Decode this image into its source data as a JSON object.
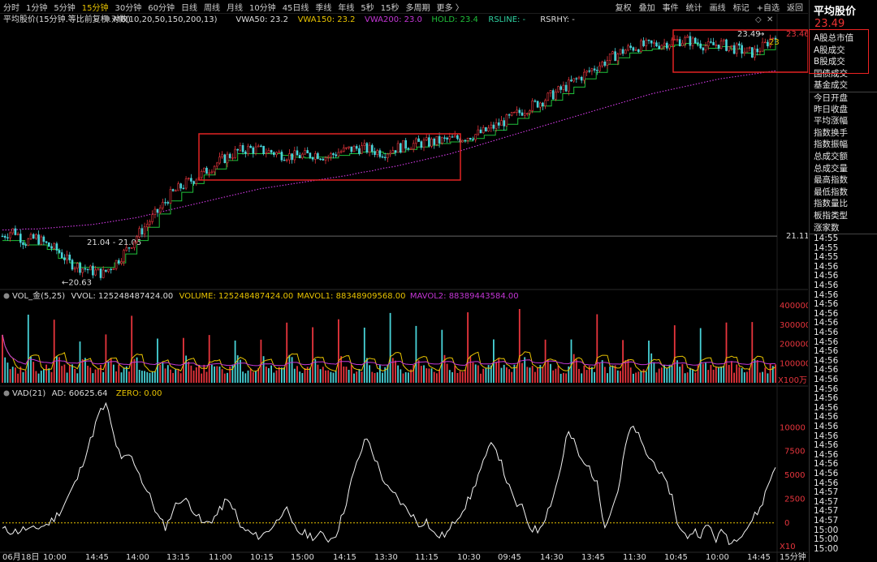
{
  "toolbar": {
    "periods": [
      "分时",
      "1分钟",
      "5分钟",
      "15分钟",
      "30分钟",
      "60分钟",
      "日线",
      "周线",
      "月线",
      "10分钟",
      "45日线",
      "季线",
      "年线",
      "5秒",
      "15秒",
      "多周期",
      "更多 〉"
    ],
    "active_period": "15分钟",
    "tools": [
      "复权",
      "叠加",
      "事件",
      "统计",
      "画线",
      "标记",
      "+自选",
      "返回"
    ]
  },
  "header": {
    "title": "平均股价(15分钟.等比前复权.对数)",
    "ma_label": "M6(10,20,50,150,200,13)",
    "vwa50": "VWA50: 23.2",
    "vwa150": "VWA150: 23.2",
    "vwa200": "VWA200: 23.0",
    "hold": "HOLD: 23.4",
    "rsline": "RSLINE: -",
    "rsrhy": "RSRHY: -"
  },
  "colors": {
    "up": "#e8353d",
    "down": "#48d3d8",
    "hold": "#1fbf3a",
    "vwa": "#c436d6",
    "vwa150": "#e8c300",
    "mavol1": "#e8c300",
    "mavol2": "#c436d6",
    "highlight": "#e22222"
  },
  "price_axis": {
    "labels": [
      "23.46",
      "21.11"
    ],
    "ref_label": "21.04 - 21.05",
    "low_label": "←20.63",
    "high_label": "23.49"
  },
  "price_chart": {
    "close": [
      21.05,
      21.12,
      20.98,
      21.03,
      20.95,
      20.88,
      20.75,
      20.7,
      20.66,
      20.63,
      20.74,
      20.88,
      21.05,
      21.2,
      21.35,
      21.52,
      21.62,
      21.7,
      21.78,
      21.88,
      21.96,
      22.03,
      22.06,
      22.04,
      22.02,
      21.99,
      21.97,
      21.98,
      22.0,
      21.96,
      22.02,
      22.05,
      22.07,
      22.04,
      22.01,
      22.06,
      22.1,
      22.12,
      22.13,
      22.15,
      22.17,
      22.19,
      22.22,
      22.26,
      22.33,
      22.4,
      22.48,
      22.56,
      22.62,
      22.7,
      22.78,
      22.87,
      22.96,
      23.05,
      23.13,
      23.22,
      23.28,
      23.31,
      23.32,
      23.34,
      23.37,
      23.38,
      23.35,
      23.3,
      23.34,
      23.29,
      23.25,
      23.22,
      23.31,
      23.46
    ],
    "hold": [
      21.0,
      21.0,
      20.95,
      20.95,
      20.9,
      20.8,
      20.75,
      20.7,
      20.7,
      20.7,
      20.75,
      20.85,
      21.0,
      21.15,
      21.3,
      21.45,
      21.55,
      21.65,
      21.75,
      21.82,
      21.92,
      22.0,
      22.0,
      22.0,
      22.0,
      21.98,
      21.96,
      21.95,
      21.96,
      21.95,
      21.98,
      22.0,
      22.02,
      22.02,
      22.0,
      22.02,
      22.05,
      22.08,
      22.1,
      22.12,
      22.14,
      22.15,
      22.18,
      22.22,
      22.28,
      22.35,
      22.42,
      22.5,
      22.57,
      22.64,
      22.72,
      22.8,
      22.9,
      22.98,
      23.08,
      23.16,
      23.22,
      23.25,
      23.27,
      23.3,
      23.32,
      23.34,
      23.32,
      23.28,
      23.3,
      23.27,
      23.22,
      23.2,
      23.26,
      23.4
    ],
    "vwa200": [
      21.12,
      21.12,
      21.13,
      21.13,
      21.14,
      21.15,
      21.16,
      21.17,
      21.18,
      21.2,
      21.22,
      21.24,
      21.26,
      21.29,
      21.32,
      21.35,
      21.38,
      21.41,
      21.44,
      21.47,
      21.5,
      21.53,
      21.56,
      21.59,
      21.61,
      21.63,
      21.65,
      21.67,
      21.69,
      21.71,
      21.73,
      21.75,
      21.78,
      21.8,
      21.83,
      21.85,
      21.88,
      21.91,
      21.94,
      21.97,
      22.0,
      22.04,
      22.08,
      22.12,
      22.16,
      22.2,
      22.24,
      22.28,
      22.32,
      22.36,
      22.4,
      22.44,
      22.48,
      22.52,
      22.56,
      22.6,
      22.64,
      22.68,
      22.72,
      22.75,
      22.78,
      22.81,
      22.84,
      22.87,
      22.9,
      22.92,
      22.94,
      22.96,
      22.98,
      23.0
    ],
    "range": [
      20.5,
      23.58
    ]
  },
  "volume_header": {
    "label": "VOL_金(5,25)",
    "vvol": "VVOL: 125248487424.00",
    "volume": "VOLUME: 125248487424.00",
    "mavol1": "MAVOL1: 88348909568.00",
    "mavol2": "MAVOL2: 88389443584.00"
  },
  "volume_axis": {
    "labels": [
      "400000",
      "300000",
      "200000",
      "100000"
    ],
    "unit": "X100万"
  },
  "volume_chart": {
    "max": 430000,
    "spikes": 30,
    "spike_level": 300000,
    "base_level": 85000
  },
  "vad_header": {
    "label": "VAD(21)",
    "ad": "AD: 60625.64",
    "zero": "ZERO: 0.00"
  },
  "vad_axis": {
    "labels": [
      "10000",
      "7500",
      "5000",
      "2500",
      "0"
    ],
    "unit": "X10"
  },
  "vad_chart": {
    "values": [
      -700,
      -850,
      -900,
      -600,
      -800,
      -400,
      -200,
      500,
      1500,
      3000,
      4500,
      6800,
      9000,
      11500,
      12400,
      9000,
      6500,
      7200,
      6000,
      4000,
      2500,
      500,
      -500,
      1500,
      2500,
      2200,
      1000,
      -200,
      200,
      1000,
      2300,
      1800,
      -500,
      -900,
      -1400,
      -1300,
      -600,
      200,
      1800,
      -300,
      -1000,
      -1200,
      -1500,
      -1200,
      -1800,
      -1000,
      1500,
      4500,
      7000,
      9000,
      7000,
      5000,
      3300,
      2800,
      1700,
      1000,
      -200,
      300,
      -1200,
      -1400,
      -1000,
      400,
      1500,
      2800,
      5000,
      6800,
      8700,
      6500,
      4000,
      2000,
      1500,
      -500,
      -800,
      600,
      2600,
      5300,
      9600,
      8300,
      6200,
      5800,
      4000,
      -200,
      1500,
      4000,
      8900,
      10200,
      8200,
      6800,
      6000,
      4400,
      3100,
      -600,
      -1500,
      -800,
      -1200,
      -200,
      -1700,
      -800,
      -2200,
      -1300,
      -700,
      500,
      1600,
      4000,
      6000
    ],
    "min": -3000,
    "max": 13000
  },
  "x_axis": {
    "labels": [
      "06月18日",
      "10:00",
      "14:45",
      "14:00",
      "13:15",
      "11:00",
      "10:15",
      "15:00",
      "14:15",
      "13:30",
      "11:15",
      "10:30",
      "09:45",
      "14:30",
      "13:45",
      "11:30",
      "10:45",
      "10:00",
      "14:45"
    ],
    "period": "15分钟"
  },
  "sidebar": {
    "title": "平均股价",
    "price": "23.49",
    "items": [
      "A股总市值",
      "A股成交",
      "B股成交",
      "国债成交",
      "基金成交",
      "今日开盘",
      "昨日收盘",
      "平均涨幅",
      "指数换手",
      "指数振幅",
      "总成交额",
      "总成交量",
      "最高指数",
      "最低指数",
      "指数量比",
      "板指类型",
      "涨家数"
    ],
    "times": [
      "14:55",
      "14:55",
      "14:55",
      "14:56",
      "14:56",
      "14:56",
      "14:56",
      "14:56",
      "14:56",
      "14:56",
      "14:56",
      "14:56",
      "14:56",
      "14:56",
      "14:56",
      "14:56",
      "14:56",
      "14:56",
      "14:56",
      "14:56",
      "14:56",
      "14:56",
      "14:56",
      "14:56",
      "14:56",
      "14:56",
      "14:56",
      "14:57",
      "14:57",
      "14:57",
      "14:57",
      "15:00",
      "15:00",
      "15:00"
    ]
  }
}
